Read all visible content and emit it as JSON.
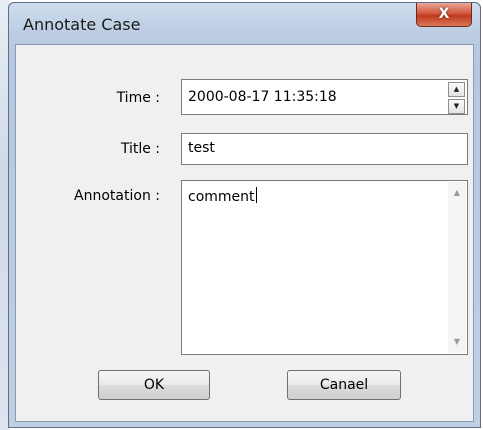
{
  "window": {
    "title": "Annotate Case",
    "close_label": "X"
  },
  "form": {
    "time_label": "Time :",
    "time_value": "2000-08-17 11:35:18",
    "title_label": "Title :",
    "title_value": "test",
    "annotation_label": "Annotation :",
    "annotation_value": "comment"
  },
  "buttons": {
    "ok": "OK",
    "cancel": "Canael"
  },
  "icons": {
    "spin_up": "spin-up-icon",
    "spin_down": "spin-down-icon",
    "scroll_up": "scroll-up-icon",
    "scroll_down": "scroll-down-icon",
    "close": "close-icon"
  }
}
